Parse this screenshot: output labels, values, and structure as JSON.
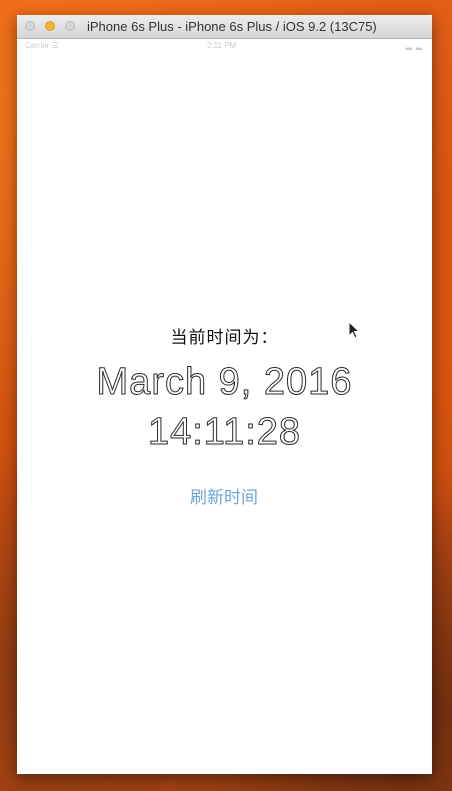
{
  "window": {
    "title": "iPhone 6s Plus - iPhone 6s Plus / iOS 9.2 (13C75)"
  },
  "statusbar": {
    "carrier": "Carrier ☰",
    "time": "2:11 PM",
    "battery": "▂▂"
  },
  "main": {
    "label": "当前时间为：",
    "date": "March 9, 2016",
    "time": "14:11:28",
    "refresh_button": "刷新时间"
  },
  "colors": {
    "accent": "#6aa6d6",
    "window_bg": "#ffffff",
    "desktop": "#e0601a"
  },
  "icons": [
    "mouse-cursor-icon"
  ]
}
